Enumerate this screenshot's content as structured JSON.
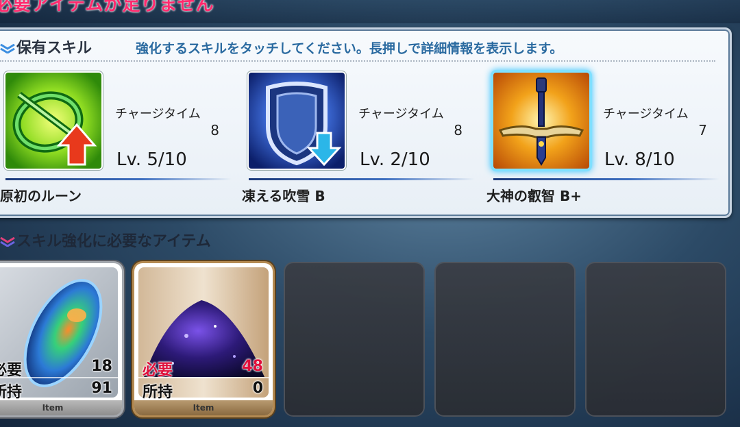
{
  "header": {
    "title": "必要アイテムが足りません"
  },
  "skills_panel": {
    "heading": "保有スキル",
    "instruction": "強化するスキルをタッチしてください。長押しで詳細情報を表示します。",
    "skills": [
      {
        "name": "原初のルーン",
        "charge_label": "チャージタイム",
        "charge_value": "8",
        "level_text": "Lv. 5/10",
        "icon": "rune-arrow-up-icon",
        "selected": false
      },
      {
        "name": "凍える吹雪 B",
        "charge_label": "チャージタイム",
        "charge_value": "8",
        "level_text": "Lv. 2/10",
        "icon": "shield-arrow-down-icon",
        "selected": false
      },
      {
        "name": "大神の叡智 B+",
        "charge_label": "チャージタイム",
        "charge_value": "7",
        "level_text": "Lv. 8/10",
        "icon": "sword-icon",
        "selected": true
      }
    ]
  },
  "items_panel": {
    "heading": "スキル強化に必要なアイテム",
    "items": [
      {
        "required_label": "必要",
        "required_value": "18",
        "owned_label": "所持",
        "owned_value": "91",
        "footer": "Item",
        "icon": "opal-gem-icon",
        "insufficient": false
      },
      {
        "required_label": "必要",
        "required_value": "48",
        "owned_label": "所持",
        "owned_value": "0",
        "footer": "Item",
        "icon": "dark-crystal-icon",
        "insufficient": true
      }
    ],
    "empty_slots": 3
  },
  "colors": {
    "warning": "#ff2a6e",
    "instruction": "#2a6aa0",
    "selected_glow": "#36c4ff",
    "insufficient": "#e0103c"
  }
}
